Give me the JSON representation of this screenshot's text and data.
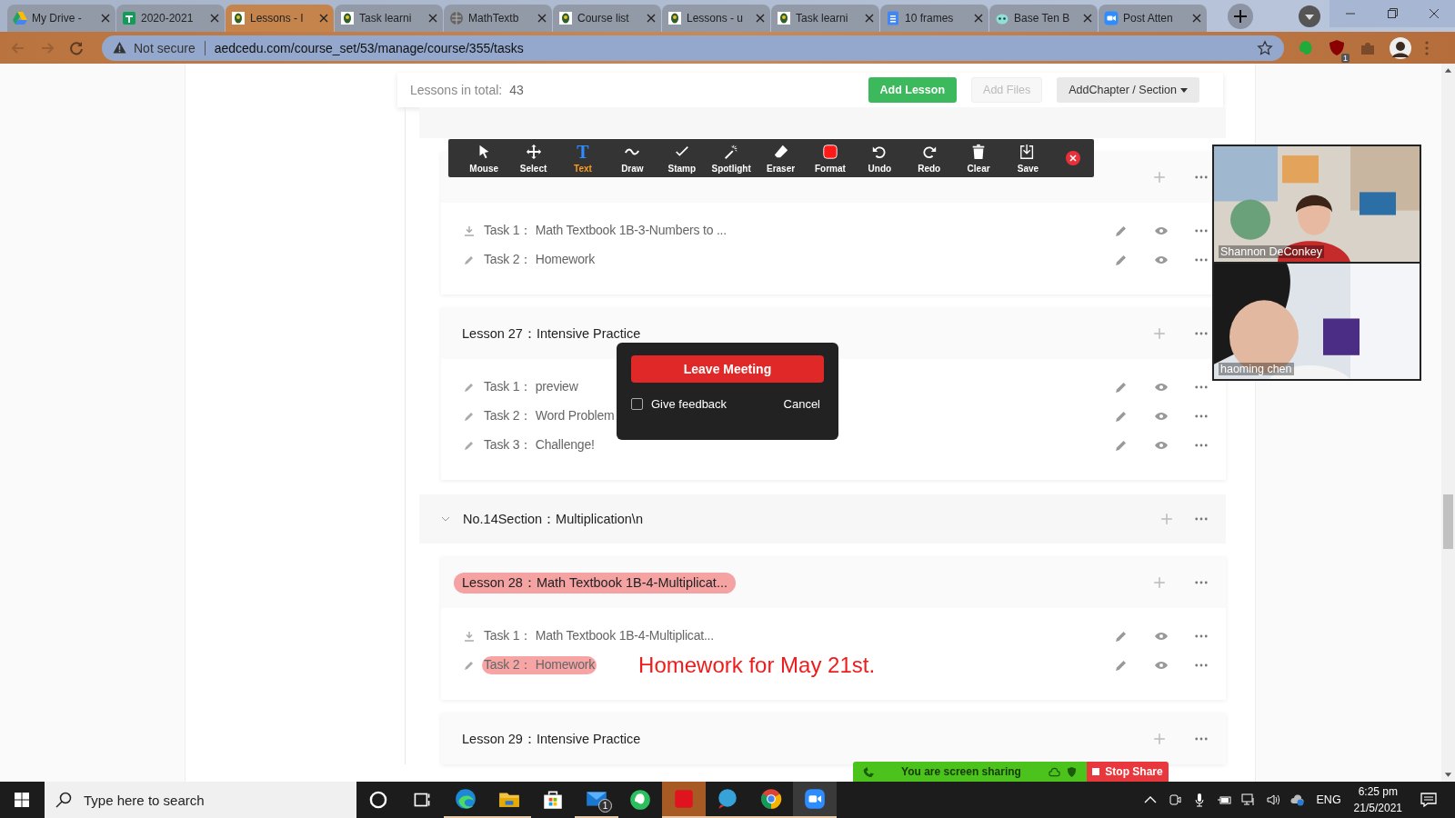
{
  "browser": {
    "tabs": [
      {
        "kind": "drive",
        "title": "My Drive -",
        "selected": false
      },
      {
        "kind": "sheets",
        "title": "2020-2021",
        "selected": false
      },
      {
        "kind": "school",
        "title": "Lessons - I",
        "selected": true
      },
      {
        "kind": "school",
        "title": "Task learni",
        "selected": false
      },
      {
        "kind": "globe",
        "title": "MathTextb",
        "selected": false
      },
      {
        "kind": "school",
        "title": "Course list",
        "selected": false
      },
      {
        "kind": "school",
        "title": "Lessons - u",
        "selected": false
      },
      {
        "kind": "school",
        "title": "Task learni",
        "selected": false
      },
      {
        "kind": "docs",
        "title": "10 frames",
        "selected": false
      },
      {
        "kind": "bot",
        "title": "Base Ten B",
        "selected": false
      },
      {
        "kind": "zoom",
        "title": "Post Atten",
        "selected": false
      }
    ],
    "security": "Not secure",
    "url": "aedcedu.com/course_set/53/manage/course/355/tasks",
    "extension_badge": "1"
  },
  "course": {
    "total_label": "Lessons in total:",
    "total": "43",
    "actions": [
      {
        "label": "Add Lesson",
        "kind": "primary"
      },
      {
        "label": "Add Files",
        "kind": "disabled"
      },
      {
        "label": "AddChapter / Section",
        "kind": "dropdown"
      }
    ],
    "items": [
      {
        "kind": "lesson",
        "tasks": [
          {
            "kind": "download",
            "label": "Task 1：",
            "name": "Math Textbook 1B-3-Numbers to ...",
            "highlighted": false
          },
          {
            "kind": "edit",
            "label": "Task 2：",
            "name": "Homework",
            "highlighted": false
          }
        ]
      },
      {
        "kind": "lesson",
        "label": "Lesson 27：",
        "name": "Intensive Practice",
        "highlighted": false,
        "tasks": [
          {
            "kind": "edit",
            "label": "Task 1：",
            "name": "preview",
            "highlighted": false
          },
          {
            "kind": "edit",
            "label": "Task 2：",
            "name": "Word Problem",
            "highlighted": false
          },
          {
            "kind": "edit",
            "label": "Task 3：",
            "name": "Challenge!",
            "highlighted": false
          }
        ]
      },
      {
        "kind": "section",
        "label": "No.14Section：",
        "name": "Multiplication\\n"
      },
      {
        "kind": "lesson",
        "label": "Lesson 28：",
        "name": "Math Textbook 1B-4-Multiplicat...",
        "highlighted": true,
        "tasks": [
          {
            "kind": "download",
            "label": "Task 1：",
            "name": "Math Textbook 1B-4-Multiplicat...",
            "highlighted": false
          },
          {
            "kind": "edit",
            "label": "Task 2：",
            "name": "Homework",
            "highlighted": true,
            "note": "Homework for May 21st."
          }
        ]
      },
      {
        "kind": "lesson",
        "label": "Lesson 29：",
        "name": "Intensive Practice",
        "highlighted": false
      }
    ]
  },
  "zoom_toolbar": {
    "tools": [
      {
        "kind": "mouse",
        "label": "Mouse",
        "selected": false
      },
      {
        "kind": "select",
        "label": "Select",
        "selected": false
      },
      {
        "kind": "text",
        "label": "Text",
        "glyph": "T",
        "selected": true
      },
      {
        "kind": "draw",
        "label": "Draw",
        "selected": false
      },
      {
        "kind": "stamp",
        "label": "Stamp",
        "selected": false
      },
      {
        "kind": "spotlight",
        "label": "Spotlight",
        "selected": false
      },
      {
        "kind": "eraser",
        "label": "Eraser",
        "selected": false
      },
      {
        "kind": "format",
        "label": "Format",
        "selected": false
      },
      {
        "kind": "undo",
        "label": "Undo",
        "selected": false
      },
      {
        "kind": "redo",
        "label": "Redo",
        "selected": false
      },
      {
        "kind": "clear",
        "label": "Clear",
        "selected": false
      },
      {
        "kind": "save",
        "label": "Save",
        "selected": false
      }
    ]
  },
  "videos": [
    {
      "name": "Shannon DeConkey"
    },
    {
      "name": "haoming chen"
    }
  ],
  "leave_dialog": {
    "leave": "Leave Meeting",
    "feedback": {
      "label": "Give feedback",
      "checked": false
    },
    "cancel": "Cancel"
  },
  "share_bar": {
    "status": "You are screen sharing",
    "stop": "Stop Share"
  },
  "taskbar": {
    "search_placeholder": "Type here to search",
    "apps": [
      {
        "kind": "cortana",
        "active": false,
        "running": false
      },
      {
        "kind": "task-view",
        "active": false,
        "running": false
      },
      {
        "kind": "edge",
        "active": false,
        "running": true
      },
      {
        "kind": "explorer",
        "active": false,
        "running": true
      },
      {
        "kind": "store",
        "active": false,
        "running": false
      },
      {
        "kind": "mail",
        "active": false,
        "running": true,
        "badge": "1"
      },
      {
        "kind": "evernote",
        "active": false,
        "running": false
      },
      {
        "kind": "itutor",
        "active": true,
        "running": true
      },
      {
        "kind": "tutor",
        "active": false,
        "running": true
      },
      {
        "kind": "chrome",
        "active": false,
        "running": true
      },
      {
        "kind": "zoom",
        "active": true,
        "running": true
      }
    ],
    "language": "ENG",
    "time": "6:25 pm",
    "date": "21/5/2021"
  }
}
